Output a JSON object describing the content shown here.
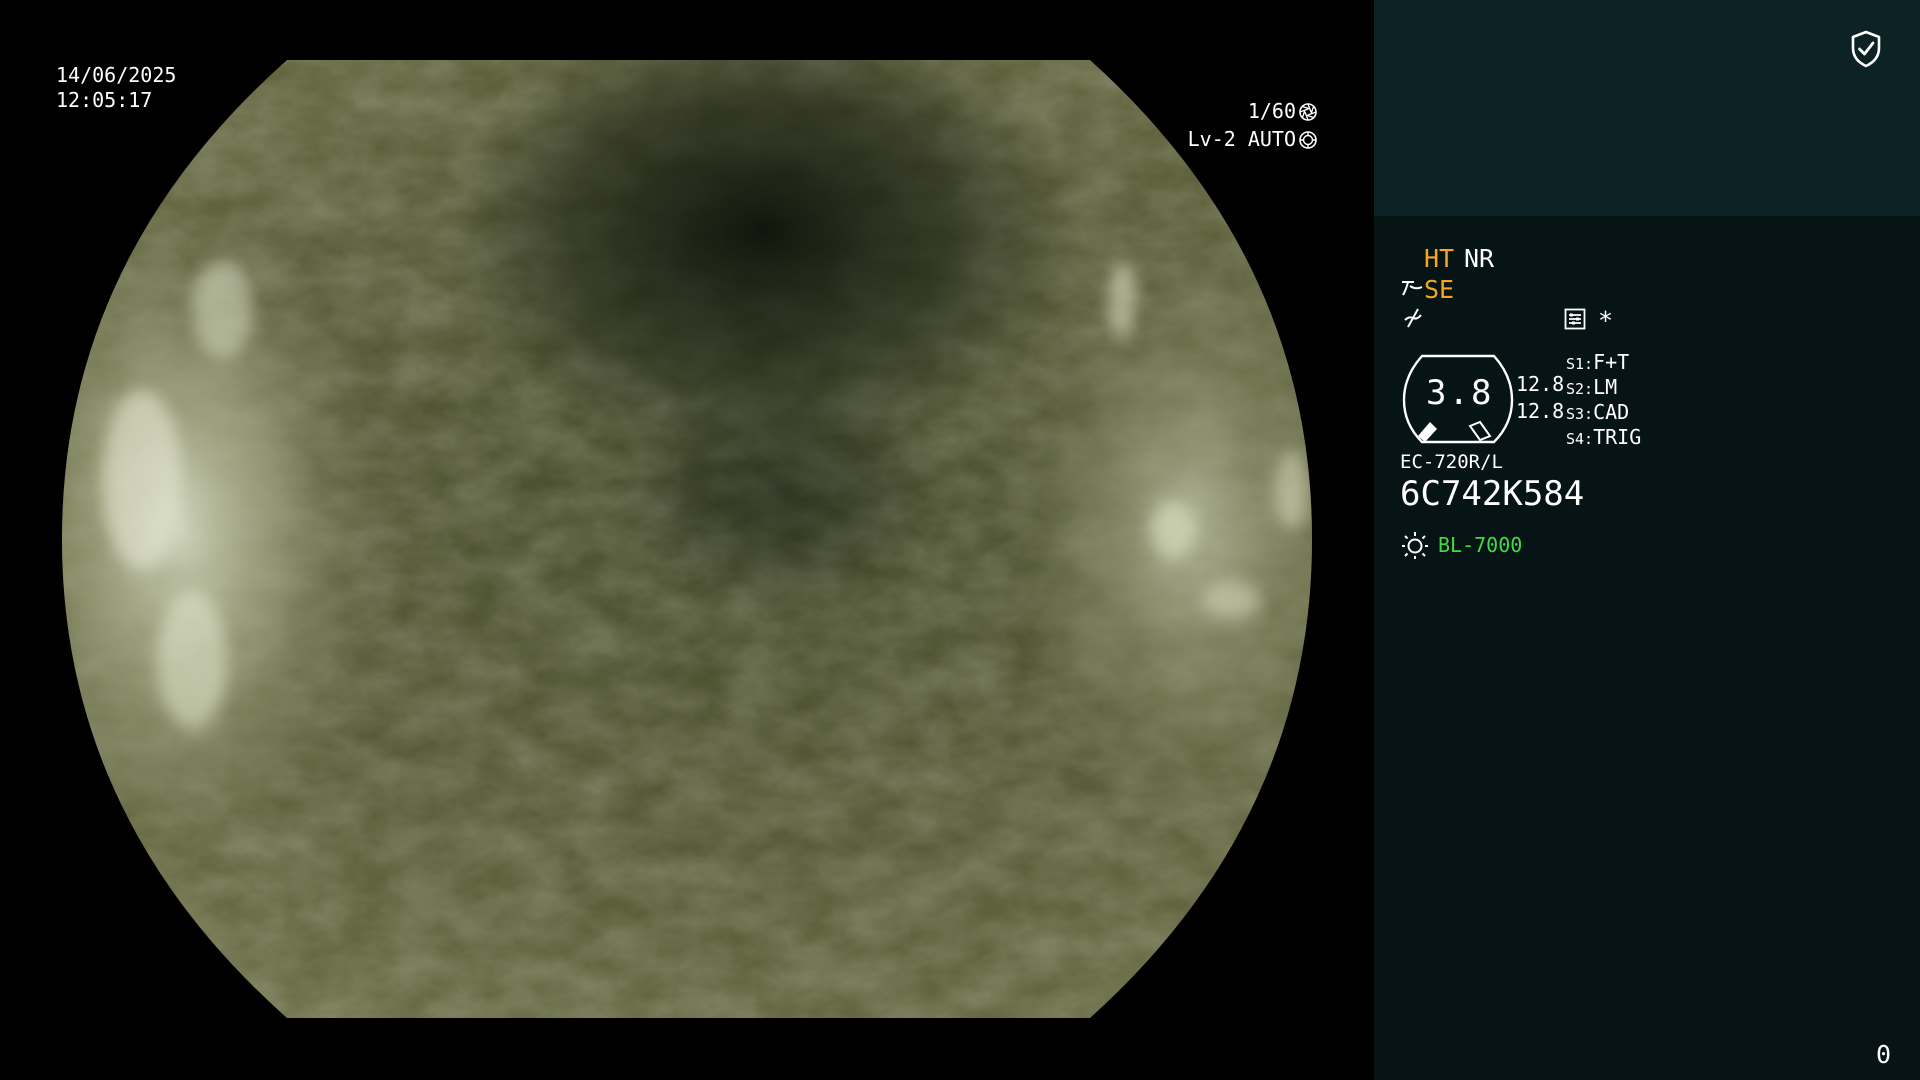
{
  "overlay": {
    "date": "14/06/2025",
    "time": "12:05:17",
    "shutter": "1/60",
    "iris": "Lv-2 AUTO"
  },
  "panel": {
    "mode_ht": "HT",
    "mode_nr": "NR",
    "mode_se": "SE",
    "asterisk": "*",
    "zoom_value": "3.8",
    "scale_top": "12.8",
    "scale_bottom": "12.8",
    "switches": [
      {
        "key": "S1:",
        "value": "F+T"
      },
      {
        "key": "S2:",
        "value": "LM"
      },
      {
        "key": "S3:",
        "value": "CAD"
      },
      {
        "key": "S4:",
        "value": "TRIG"
      }
    ],
    "scope_model": "EC-720R/L",
    "scope_serial": "6C742K584",
    "light_source": "BL-7000",
    "counter": "0"
  },
  "icons": {
    "security": "shield-check-icon",
    "shutter": "aperture-icon",
    "iris": "iris-icon",
    "structure": "sharpen-icon",
    "color": "color-enhance-icon",
    "settings": "list-settings-icon",
    "light": "sun-icon"
  },
  "colors": {
    "accent_orange": "#f5a623",
    "light_green": "#40dd40",
    "panel_top": "#0c2224",
    "panel_bottom": "#061415"
  }
}
